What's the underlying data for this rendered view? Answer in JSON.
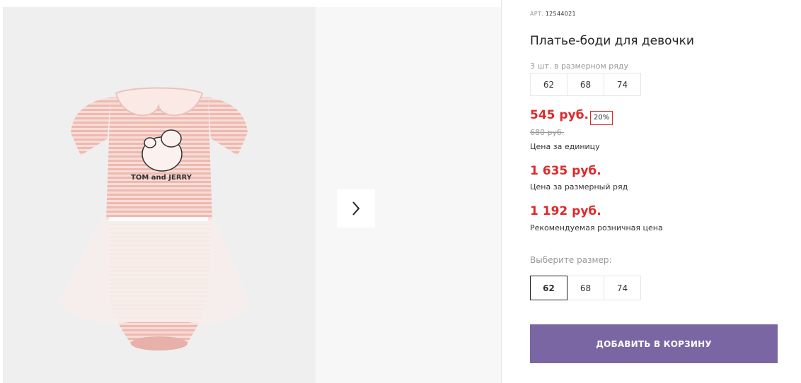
{
  "product": {
    "article_label": "АРТ.",
    "article": "12544021",
    "title": "Платье-боди для девочки",
    "pack_label": "3 шт. в размерном ряду",
    "pack_sizes": [
      "62",
      "68",
      "74"
    ],
    "price": "545 руб.",
    "discount": "20%",
    "old_price": "680 руб.",
    "unit_caption": "Цена за единицу",
    "set_price": "1 635 руб.",
    "set_caption": "Цена за размерный ряд",
    "retail_price": "1 192 руб.",
    "retail_caption": "Рекомендуемая розничная цена",
    "choose_label": "Выберите размер:",
    "choose_sizes": [
      "62",
      "68",
      "74"
    ],
    "selected_size": "62",
    "cart_button": "ДОБАВИТЬ В КОРЗИНУ"
  },
  "gallery": {
    "image_print_text": "TOM and JERRY",
    "next_icon": "chevron-right-icon"
  },
  "colors": {
    "price_red": "#e0282a",
    "cart_purple": "#7a66a3",
    "garment_pink": "#f3c9c2"
  }
}
